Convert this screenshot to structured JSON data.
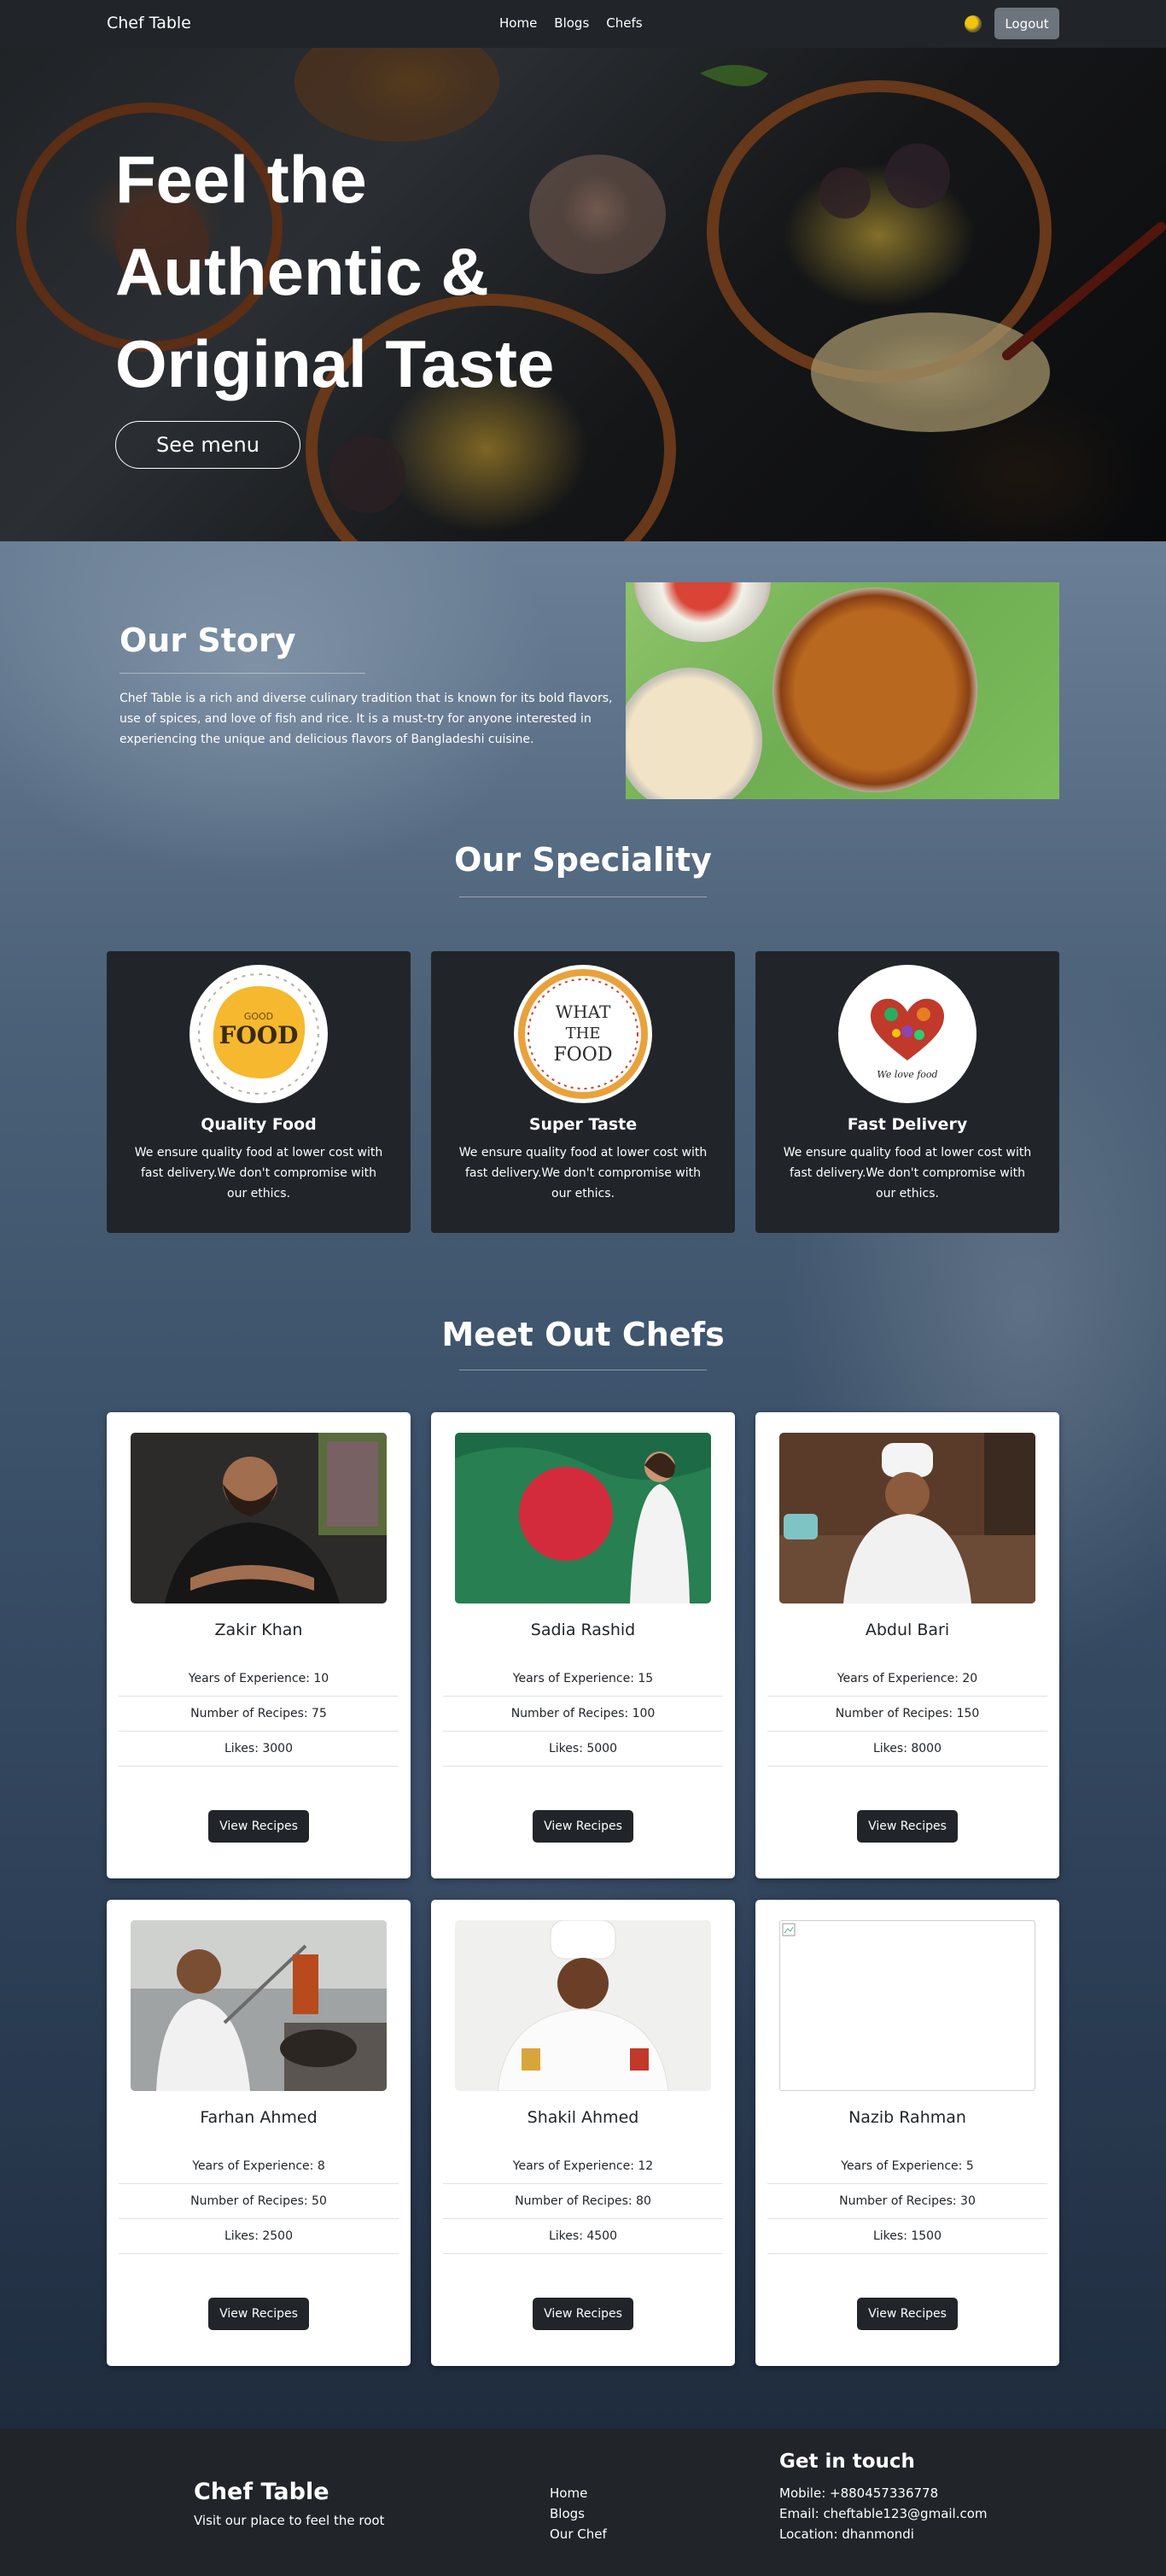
{
  "navbar": {
    "brand": "Chef Table",
    "links": [
      "Home",
      "Blogs",
      "Chefs"
    ],
    "logout_label": "Logout"
  },
  "hero": {
    "title_lines": [
      "Feel the",
      "Authentic &",
      "Original Taste"
    ],
    "button_label": "See menu"
  },
  "story": {
    "title": "Our Story",
    "text": "Chef Table is a rich and diverse culinary tradition that is known for its bold flavors, use of spices, and love of fish and rice. It is a must-try for anyone interested in experiencing the unique and delicious flavors of Bangladeshi cuisine."
  },
  "speciality": {
    "title": "Our Speciality",
    "items": [
      {
        "title": "Quality Food",
        "desc": "We ensure quality food at lower cost with fast delivery.We don't compromise with our ethics.",
        "badge_word": "FOOD",
        "badge_small": "GOOD"
      },
      {
        "title": "Super Taste",
        "desc": "We ensure quality food at lower cost with fast delivery.We don't compromise with our ethics.",
        "badge_lines": [
          "WHAT",
          "THE",
          "FOOD"
        ]
      },
      {
        "title": "Fast Delivery",
        "desc": "We ensure quality food at lower cost with fast delivery.We don't compromise with our ethics.",
        "badge_script": "We love food"
      }
    ]
  },
  "chefs_section": {
    "title": "Meet Out Chefs",
    "view_label": "View Recipes",
    "chefs": [
      {
        "name": "Zakir Khan",
        "experience": "Years of Experience: 10",
        "recipes": "Number of Recipes: 75",
        "likes": "Likes: 3000"
      },
      {
        "name": "Sadia Rashid",
        "experience": "Years of Experience: 15",
        "recipes": "Number of Recipes: 100",
        "likes": "Likes: 5000"
      },
      {
        "name": "Abdul Bari",
        "experience": "Years of Experience: 20",
        "recipes": "Number of Recipes: 150",
        "likes": "Likes: 8000"
      },
      {
        "name": "Farhan Ahmed",
        "experience": "Years of Experience: 8",
        "recipes": "Number of Recipes: 50",
        "likes": "Likes: 2500"
      },
      {
        "name": "Shakil Ahmed",
        "experience": "Years of Experience: 12",
        "recipes": "Number of Recipes: 80",
        "likes": "Likes: 4500"
      },
      {
        "name": "Nazib Rahman",
        "experience": "Years of Experience: 5",
        "recipes": "Number of Recipes: 30",
        "likes": "Likes: 1500"
      }
    ]
  },
  "footer": {
    "brand": "Chef Table",
    "tagline": "Visit our place to feel the root",
    "links": [
      "Home",
      "Blogs",
      "Our Chef"
    ],
    "contact_title": "Get in touch",
    "mobile": "Mobile: +880457336778",
    "email": "Email: cheftable123@gmail.com",
    "location": "Location: dhanmondi"
  },
  "colors": {
    "dark": "#212529",
    "button_grey": "#6c757d",
    "white": "#ffffff"
  }
}
